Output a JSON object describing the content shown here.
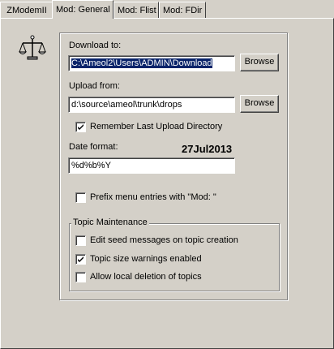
{
  "tabs": [
    {
      "label": "ZModemII"
    },
    {
      "label": "Mod: General"
    },
    {
      "label": "Mod: Flist"
    },
    {
      "label": "Mod: FDir"
    }
  ],
  "active_tab": "Mod: General",
  "download": {
    "label": "Download to:",
    "value": "C:\\Ameol2\\Users\\ADMIN\\Download",
    "browse_label": "Browse"
  },
  "upload": {
    "label": "Upload from:",
    "value": "d:\\source\\ameol\\trunk\\drops",
    "browse_label": "Browse"
  },
  "remember_upload": {
    "label": "Remember Last Upload Directory",
    "checked": true
  },
  "date": {
    "label": "Date format:",
    "preview": "27Jul2013",
    "value": "%d%b%Y"
  },
  "prefix_menu": {
    "label": "Prefix menu entries with \"Mod: \"",
    "checked": false
  },
  "topic_maintenance": {
    "title": "Topic Maintenance",
    "options": [
      {
        "label": "Edit seed messages on topic creation",
        "checked": false
      },
      {
        "label": "Topic size warnings enabled",
        "checked": true
      },
      {
        "label": "Allow local deletion of topics",
        "checked": false
      }
    ]
  },
  "icons": {
    "scales": "scales-icon",
    "check": "checkmark-icon"
  }
}
